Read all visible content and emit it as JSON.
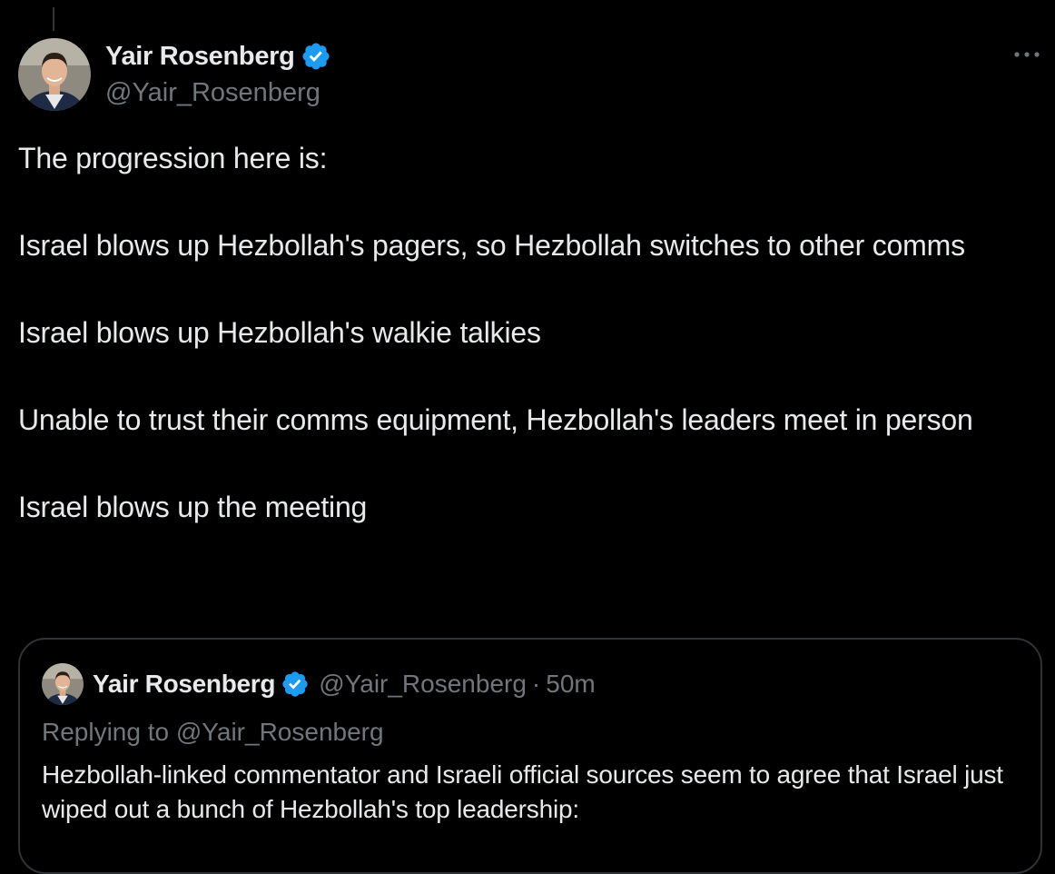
{
  "tweet": {
    "author": {
      "display_name": "Yair Rosenberg",
      "handle": "@Yair_Rosenberg",
      "verified": true
    },
    "paragraphs": [
      "The progression here is:",
      "Israel blows up Hezbollah's pagers, so Hezbollah switches to other comms",
      "Israel blows up Hezbollah's walkie talkies",
      "Unable to trust their comms equipment, Hezbollah's leaders meet in person",
      "Israel blows up the meeting"
    ],
    "more_icon": "more-horizontal-icon"
  },
  "quoted_tweet": {
    "author": {
      "display_name": "Yair Rosenberg",
      "handle": "@Yair_Rosenberg",
      "verified": true
    },
    "separator": "·",
    "timestamp": "50m",
    "replying_to": "Replying to @Yair_Rosenberg",
    "text": "Hezbollah-linked commentator and Israeli official sources seem to agree that Israel just wiped out a bunch of Hezbollah's top leadership:"
  },
  "colors": {
    "background": "#000000",
    "primary_text": "#e7e9ea",
    "secondary_text": "#71767b",
    "verified_blue": "#1d9bf0",
    "border": "#2f3336"
  }
}
